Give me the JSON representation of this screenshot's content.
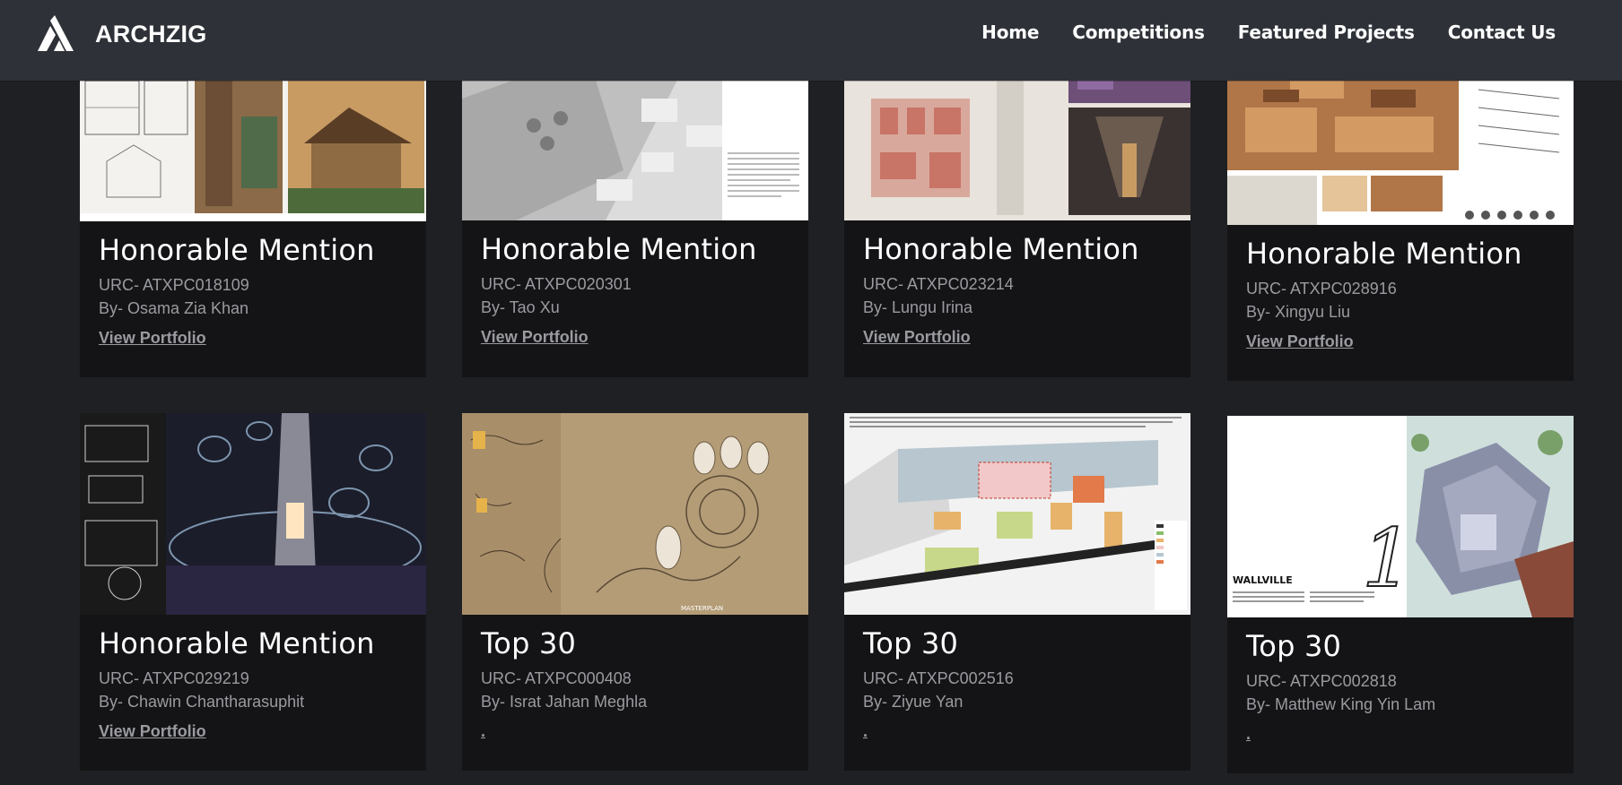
{
  "brand": {
    "name": "ARCHZIG",
    "logo_icon": "archzig-logo-icon"
  },
  "nav": [
    {
      "label": "Home"
    },
    {
      "label": "Competitions"
    },
    {
      "label": "Featured Projects"
    },
    {
      "label": "Contact Us"
    }
  ],
  "cards": [
    {
      "rank": "Honorable Mention",
      "urc": "URC- ATXPC018109",
      "by": "By- Osama Zia Khan",
      "link": "View Portfolio"
    },
    {
      "rank": "Honorable Mention",
      "urc": "URC- ATXPC020301",
      "by": "By- Tao Xu",
      "link": "View Portfolio"
    },
    {
      "rank": "Honorable Mention",
      "urc": "URC- ATXPC023214",
      "by": "By- Lungu Irina",
      "link": "View Portfolio"
    },
    {
      "rank": "Honorable Mention",
      "urc": "URC- ATXPC028916",
      "by": "By- Xingyu Liu",
      "link": "View Portfolio"
    },
    {
      "rank": "Honorable Mention",
      "urc": "URC- ATXPC029219",
      "by": "By- Chawin Chantharasuphit",
      "link": "View Portfolio"
    },
    {
      "rank": "Top 30",
      "urc": "URC- ATXPC000408",
      "by": "By- Israt Jahan Meghla",
      "link": "."
    },
    {
      "rank": "Top 30",
      "urc": "URC- ATXPC002516",
      "by": "By- Ziyue Yan",
      "link": "."
    },
    {
      "rank": "Top 30",
      "urc": "URC- ATXPC002818",
      "by": "By- Matthew King Yin Lam",
      "link": "."
    }
  ],
  "thumb_text": {
    "wallville": "WALLVILLE",
    "masterplan": "MASTERPLAN"
  },
  "colors": {
    "header": "#2e3238",
    "page": "#1f2024",
    "card": "#141416",
    "muted": "#9a9ba0"
  }
}
